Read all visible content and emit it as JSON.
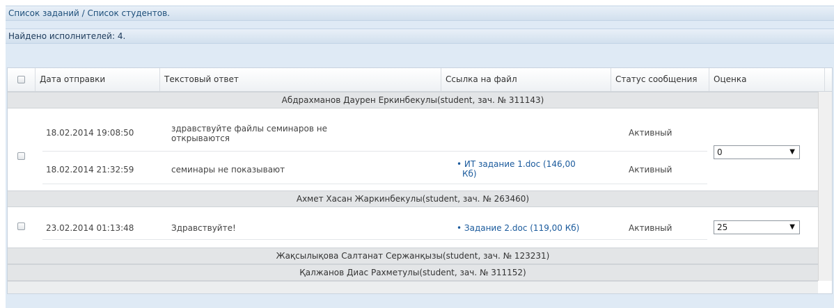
{
  "header": {
    "breadcrumb": "Список заданий / Список студентов.",
    "found": "Найдено исполнителей: 4."
  },
  "table": {
    "columns": [
      "Дата отправки",
      "Текстовый ответ",
      "Ссылка на файл",
      "Статус сообщения",
      "Оценка"
    ],
    "groups": [
      {
        "student": "Абдрахманов Даурен Еркинбекулы(student, зач. № 311143)",
        "grade": "0",
        "rows": [
          {
            "date": "18.02.2014 19:08:50",
            "text_line1": "здравствуйте файлы семинаров не",
            "text_line2": "открываются",
            "file_line1": "",
            "file_line2": "",
            "status": "Активный"
          },
          {
            "date": "18.02.2014 21:32:59",
            "text_line1": "семинары не показывают",
            "text_line2": "",
            "file_line1": "• ИТ задание 1.doc (146,00",
            "file_line2": "Кб)",
            "status": "Активный"
          }
        ]
      },
      {
        "student": "Ахмет Хасан Жаркинбекулы(student, зач. № 263460)",
        "grade": "25",
        "rows": [
          {
            "date": "23.02.2014 01:13:48",
            "text_line1": "Здравствуйте!",
            "text_line2": "",
            "file_line1": "• Задание 2.doc (119,00 Кб)",
            "file_line2": "",
            "status": "Активный"
          }
        ]
      },
      {
        "student": "Жақсылықова Салтанат Сержанқызы(student, зач. № 123231)"
      },
      {
        "student": "Қалжанов Диас Рахметулы(student, зач. № 311152)"
      }
    ]
  }
}
